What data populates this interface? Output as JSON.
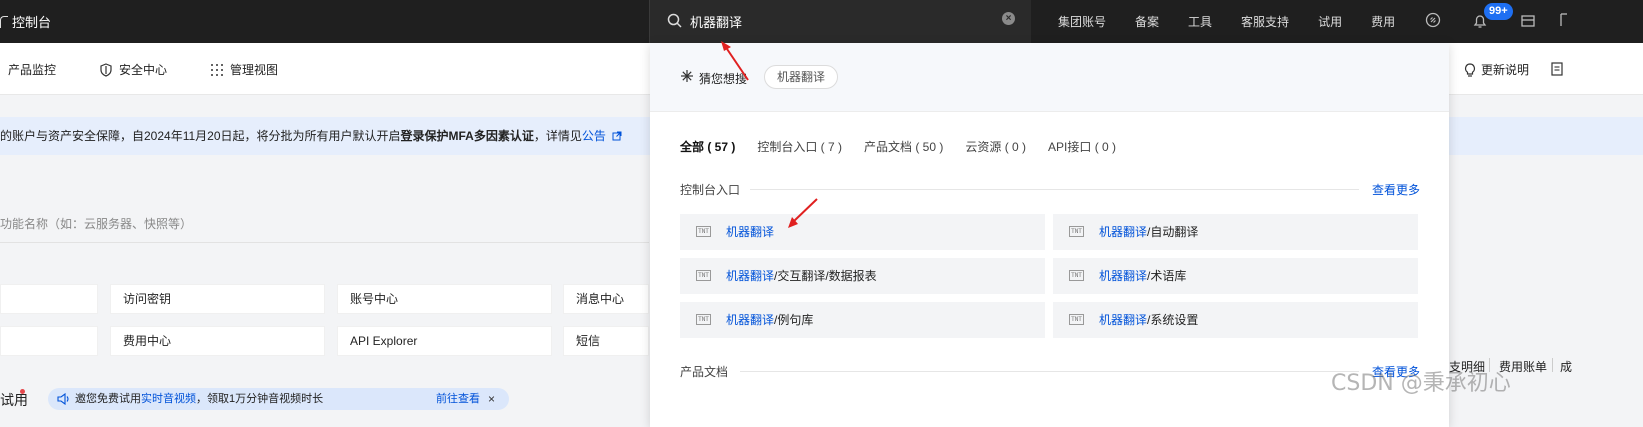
{
  "topbar": {
    "brand": "控制台",
    "search_value": "机器翻译",
    "nav": [
      "集团账号",
      "备案",
      "工具",
      "客服支持",
      "试用",
      "费用"
    ],
    "badge": "99+"
  },
  "subbar": {
    "items": [
      "产品监控",
      "安全中心",
      "管理视图"
    ],
    "update_notes": "更新说明"
  },
  "notice": {
    "text_before": "的账户与资产安全保障，自2024年11月20日起，将分批为所有用户默认开启",
    "bold": "登录保护MFA多因素认证",
    "text_after": "，详情见",
    "link": "公告"
  },
  "background": {
    "search_placeholder": "功能名称（如：云服务器、快照等）",
    "tiles": [
      "访问密钥",
      "账号中心",
      "消息中心",
      "费用中心",
      "API Explorer",
      "短信"
    ],
    "trial_label": "试用",
    "promo_before": "邀您免费试用",
    "promo_link": "实时音视频",
    "promo_after": "，领取1万分钟音视频时长",
    "promo_go": "前往查看",
    "promo_close": "×",
    "right_frags": [
      "支明细",
      "费用账单",
      "成"
    ]
  },
  "panel": {
    "guess_label": "猜您想搜",
    "guess_tag": "机器翻译",
    "tabs": [
      "全部 ( 57 )",
      "控制台入口 ( 7 )",
      "产品文档 ( 50 )",
      "云资源 ( 0 )",
      "API接口 ( 0 )"
    ],
    "section_console": "控制台入口",
    "more": "查看更多",
    "section_docs": "产品文档",
    "results": [
      {
        "hl": "机器翻译",
        "rest": ""
      },
      {
        "hl": "机器翻译",
        "rest": "/自动翻译"
      },
      {
        "hl": "机器翻译",
        "rest": "/交互翻译/数据报表"
      },
      {
        "hl": "机器翻译",
        "rest": "/术语库"
      },
      {
        "hl": "机器翻译",
        "rest": "/例句库"
      },
      {
        "hl": "机器翻译",
        "rest": "/系统设置"
      }
    ],
    "result_icon_text": "TNT"
  },
  "watermark": "CSDN @秉承初心",
  "colors": {
    "accent": "#0052d9",
    "topbar": "#1f1f1f",
    "badge": "#1e6ff2",
    "arrow": "#e02020"
  }
}
